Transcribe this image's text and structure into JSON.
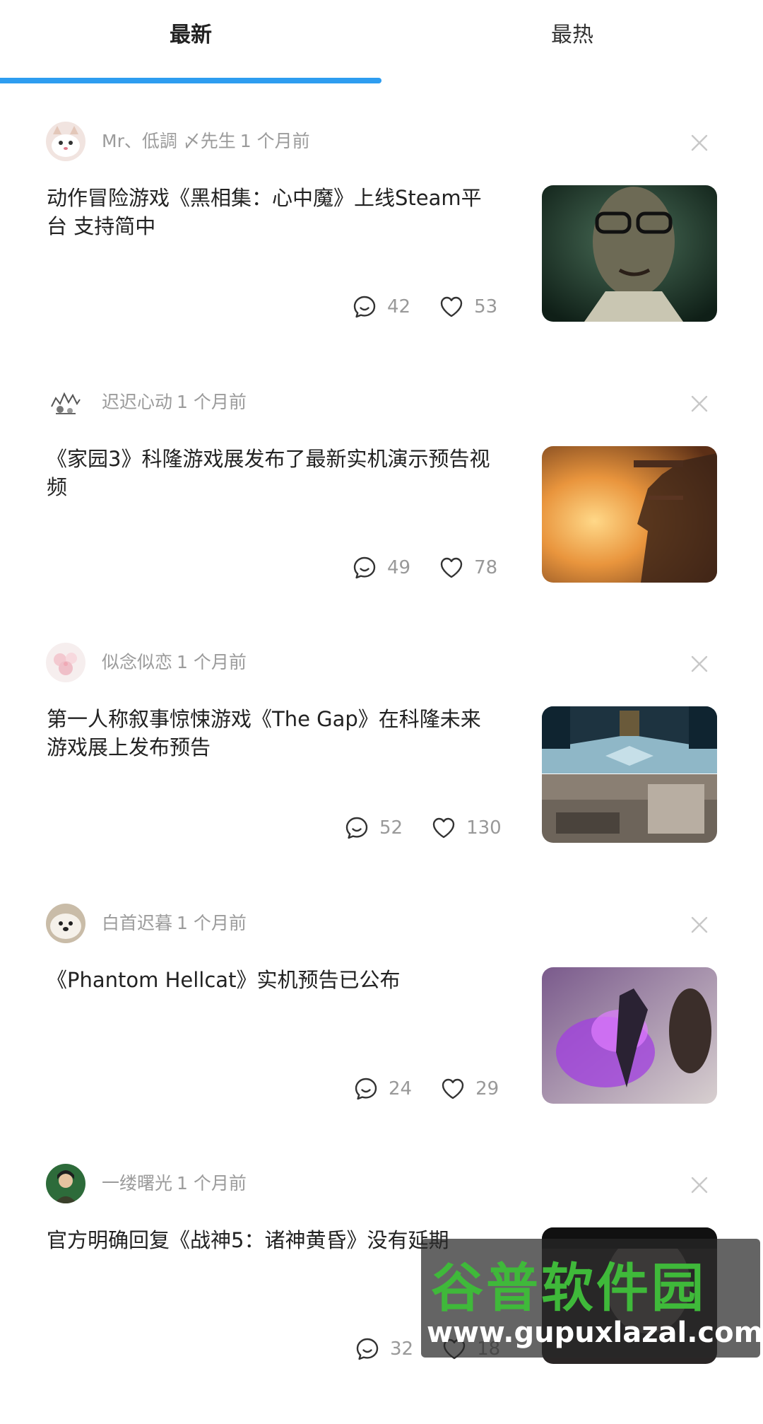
{
  "tabs": [
    {
      "label": "最新",
      "active": true
    },
    {
      "label": "最热",
      "active": false
    }
  ],
  "accent_color": "#2e9df0",
  "feed": [
    {
      "author": "Mr、低調 〆先生",
      "time": "1 个月前",
      "title": "动作冒险游戏《黑相集：心中魔》上线Steam平台 支持简中",
      "comments": "42",
      "likes": "53"
    },
    {
      "author": "迟迟心动",
      "time": "1 个月前",
      "title": "《家园3》科隆游戏展发布了最新实机演示预告视频",
      "comments": "49",
      "likes": "78"
    },
    {
      "author": "似念似恋",
      "time": "1 个月前",
      "title": "第一人称叙事惊悚游戏《The Gap》在科隆未来游戏展上发布预告",
      "comments": "52",
      "likes": "130"
    },
    {
      "author": "白首迟暮",
      "time": "1 个月前",
      "title": "《Phantom Hellcat》实机预告已公布",
      "comments": "24",
      "likes": "29"
    },
    {
      "author": "一缕曙光",
      "time": "1 个月前",
      "title": "官方明确回复《战神5：诸神黄昏》没有延期",
      "comments": "32",
      "likes": "18"
    }
  ],
  "watermark": {
    "name": "谷普软件园",
    "url": "www.gupuxlazal.com"
  },
  "icons": {
    "comment": "comment-icon",
    "like": "heart-icon",
    "dismiss": "close-icon"
  }
}
